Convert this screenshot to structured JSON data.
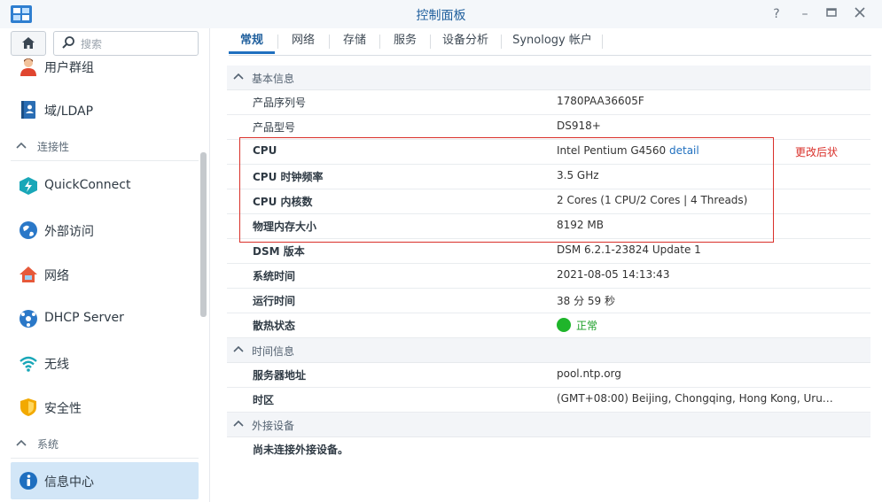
{
  "window": {
    "title": "控制面板"
  },
  "search": {
    "placeholder": "搜索"
  },
  "sidebar": {
    "items": [
      {
        "label": "用户群组",
        "icon": "user-group-icon"
      },
      {
        "label": "域/LDAP",
        "icon": "domain-ldap-icon"
      },
      {
        "group": "连接性"
      },
      {
        "label": "QuickConnect",
        "icon": "quickconnect-icon"
      },
      {
        "label": "外部访问",
        "icon": "external-access-icon"
      },
      {
        "label": "网络",
        "icon": "network-icon"
      },
      {
        "label": "DHCP Server",
        "icon": "dhcp-server-icon"
      },
      {
        "label": "无线",
        "icon": "wifi-icon"
      },
      {
        "label": "安全性",
        "icon": "security-shield-icon"
      },
      {
        "group": "系统"
      },
      {
        "label": "信息中心",
        "icon": "info-center-icon",
        "active": true
      }
    ]
  },
  "tabs": [
    {
      "label": "常规",
      "active": true
    },
    {
      "label": "网络"
    },
    {
      "label": "存储"
    },
    {
      "label": "服务"
    },
    {
      "label": "设备分析"
    },
    {
      "label": "Synology 帐户"
    }
  ],
  "sections": {
    "basic": {
      "title": "基本信息",
      "rows": [
        {
          "key": "产品序列号",
          "value": "1780PAA36605F"
        },
        {
          "key": "产品型号",
          "value": "DS918+"
        },
        {
          "key": "CPU",
          "value": "Intel Pentium G4560",
          "link": "detail"
        },
        {
          "key": "CPU 时钟频率",
          "value": "3.5 GHz"
        },
        {
          "key": "CPU 内核数",
          "value": "2 Cores (1 CPU/2 Cores | 4 Threads)"
        },
        {
          "key": "物理内存大小",
          "value": "8192 MB"
        },
        {
          "key": "DSM 版本",
          "value": "DSM 6.2.1-23824 Update 1"
        },
        {
          "key": "系统时间",
          "value": "2021-08-05 14:13:43"
        },
        {
          "key": "运行时间",
          "value": "38 分 59 秒"
        },
        {
          "key": "散热状态",
          "value": "正常"
        }
      ]
    },
    "time": {
      "title": "时间信息",
      "rows": [
        {
          "key": "服务器地址",
          "value": "pool.ntp.org"
        },
        {
          "key": "时区",
          "value": "(GMT+08:00) Beijing, Chongqing, Hong Kong, Uru…"
        }
      ]
    },
    "external": {
      "title": "外接设备",
      "rows": [
        {
          "key": "尚未连接外接设备。"
        }
      ]
    }
  },
  "annotation": {
    "note": "更改后状"
  },
  "colors": {
    "accent": "#1f6fbf",
    "annotation": "#d9302a",
    "ok": "#1fb52b"
  }
}
